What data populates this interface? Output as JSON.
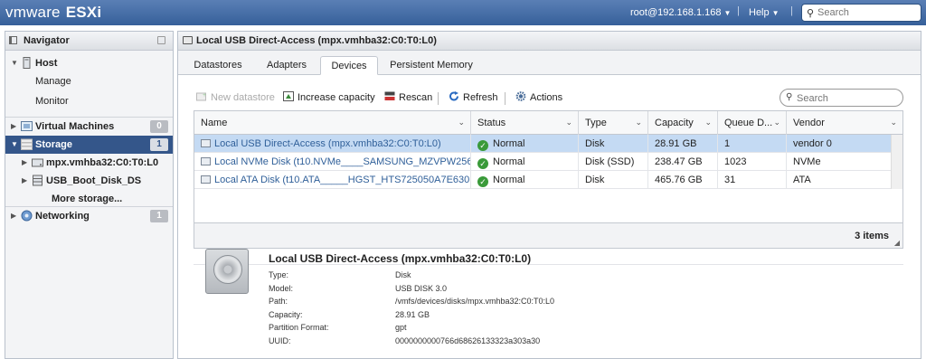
{
  "topbar": {
    "brand": "vm",
    "brand2": "ware",
    "product": "ESXi",
    "user": "root@192.168.1.168",
    "help": "Help",
    "search_placeholder": "Search"
  },
  "navigator": {
    "title": "Navigator",
    "host": "Host",
    "manage": "Manage",
    "monitor": "Monitor",
    "vms": "Virtual Machines",
    "vms_count": "0",
    "storage": "Storage",
    "storage_count": "1",
    "dev1": "mpx.vmhba32:C0:T0:L0",
    "ds1": "USB_Boot_Disk_DS",
    "more_storage": "More storage...",
    "networking": "Networking",
    "networking_count": "1"
  },
  "content": {
    "title": "Local USB Direct-Access (mpx.vmhba32:C0:T0:L0)",
    "tabs": [
      "Datastores",
      "Adapters",
      "Devices",
      "Persistent Memory"
    ],
    "active_tab": "Devices",
    "toolbar": {
      "new_datastore": "New datastore",
      "increase_capacity": "Increase capacity",
      "rescan": "Rescan",
      "refresh": "Refresh",
      "actions": "Actions"
    },
    "search_placeholder": "Search",
    "columns": [
      "Name",
      "Status",
      "Type",
      "Capacity",
      "Queue D...",
      "Vendor"
    ],
    "rows": [
      {
        "name": "Local USB Direct-Access (mpx.vmhba32:C0:T0:L0)",
        "status": "Normal",
        "type": "Disk",
        "capacity": "28.91 GB",
        "queue": "1",
        "vendor": "vendor 0"
      },
      {
        "name": "Local NVMe Disk (t10.NVMe____SAMSUNG_MZVPW256...",
        "status": "Normal",
        "type": "Disk (SSD)",
        "capacity": "238.47 GB",
        "queue": "1023",
        "vendor": "NVMe"
      },
      {
        "name": "Local ATA Disk (t10.ATA_____HGST_HTS725050A7E630...",
        "status": "Normal",
        "type": "Disk",
        "capacity": "465.76 GB",
        "queue": "31",
        "vendor": "ATA"
      }
    ],
    "item_count": "3 items"
  },
  "details": {
    "title": "Local USB Direct-Access (mpx.vmhba32:C0:T0:L0)",
    "props": [
      {
        "key": "Type:",
        "value": "Disk"
      },
      {
        "key": "Model:",
        "value": "USB DISK 3.0"
      },
      {
        "key": "Path:",
        "value": "/vmfs/devices/disks/mpx.vmhba32:C0:T0:L0"
      },
      {
        "key": "Capacity:",
        "value": "28.91 GB"
      },
      {
        "key": "Partition Format:",
        "value": "gpt"
      },
      {
        "key": "UUID:",
        "value": "0000000000766d68626133323a303a30"
      }
    ]
  },
  "colors": {
    "topbar": "#36609a",
    "selected_nav": "#34568a",
    "selected_row": "#c4daf3",
    "ok_status": "#3a9a3a"
  }
}
